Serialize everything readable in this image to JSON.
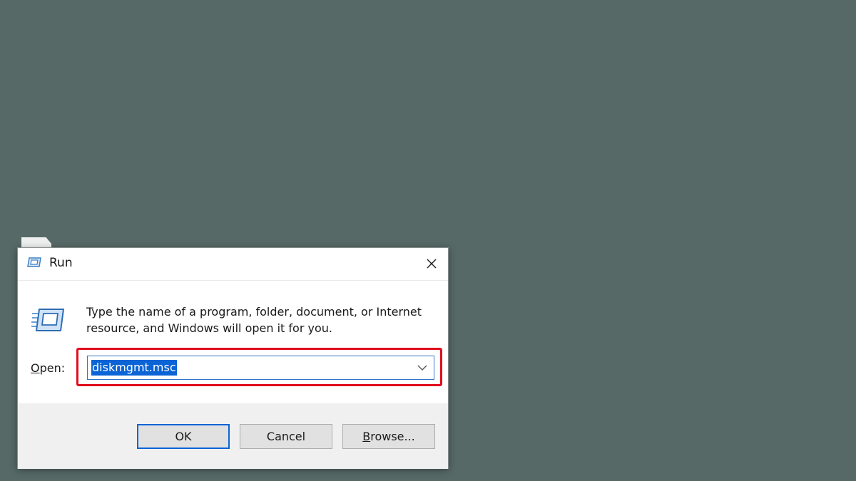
{
  "window": {
    "title": "Run",
    "title_icon": "run-icon",
    "close_icon": "close-icon"
  },
  "dialog": {
    "description": "Type the name of a program, folder, document, or Internet resource, and Windows will open it for you.",
    "open_label_mnemonic": "O",
    "open_label_rest": "pen:",
    "open_value": "diskmgmt.msc",
    "dropdown_icon": "chevron-down-icon"
  },
  "buttons": {
    "ok": "OK",
    "cancel": "Cancel",
    "browse_mnemonic": "B",
    "browse_rest": "rowse..."
  },
  "colors": {
    "desktop": "#566966",
    "highlight": "#e10d1c",
    "selection": "#0a64d6",
    "footer": "#f0f0f0"
  }
}
